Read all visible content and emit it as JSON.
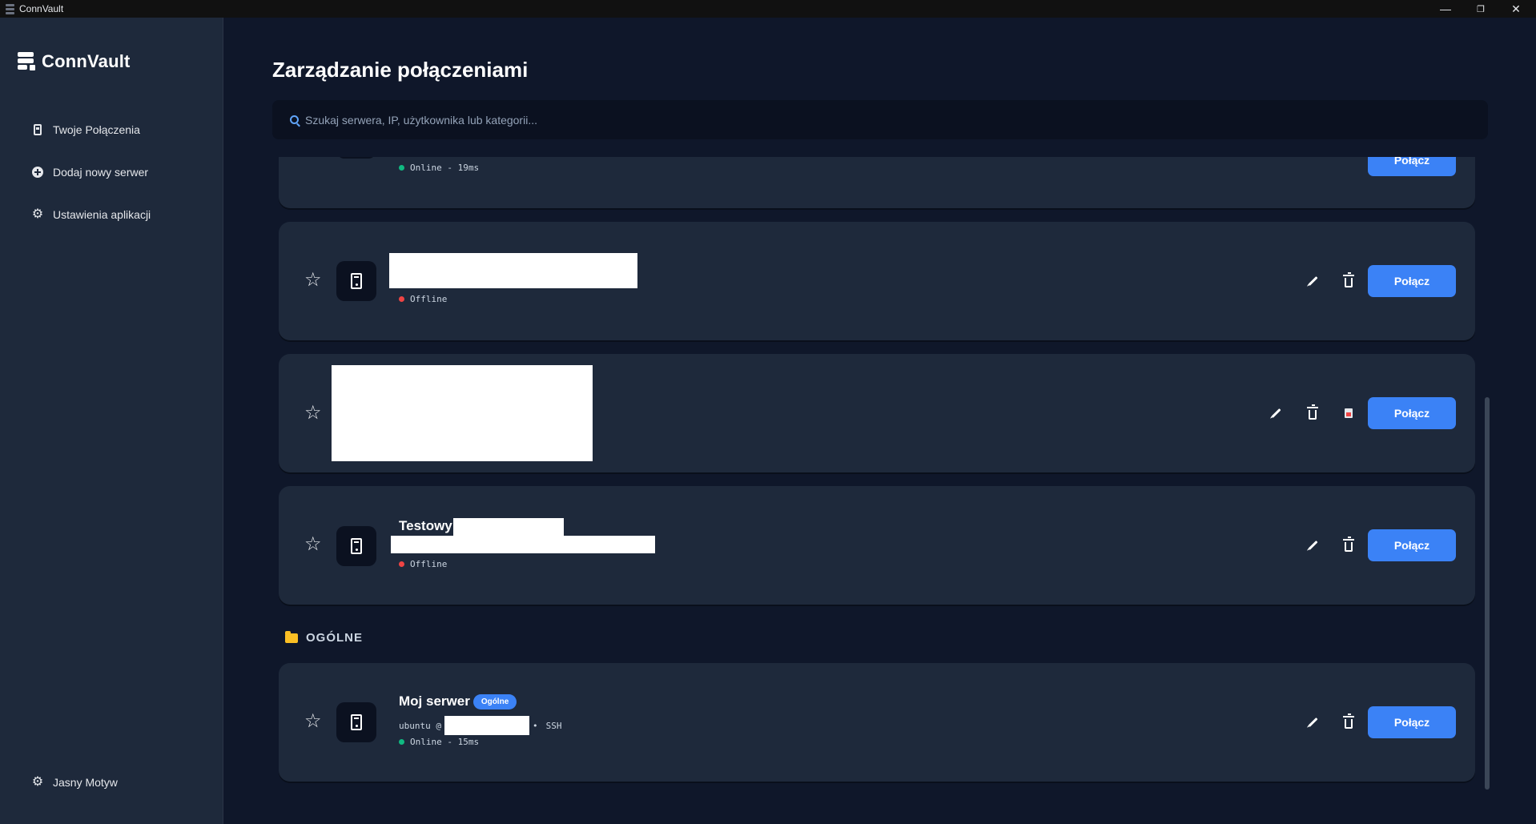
{
  "window": {
    "title": "ConnVault",
    "minimize": "—",
    "restore": "❐",
    "close": "✕"
  },
  "sidebar": {
    "brand": "ConnVault",
    "items": [
      {
        "label": "Twoje Połączenia",
        "icon": "server-icon"
      },
      {
        "label": "Dodaj nowy serwer",
        "icon": "plus-circle-icon"
      },
      {
        "label": "Ustawienia aplikacji",
        "icon": "gear-icon"
      }
    ],
    "theme_toggle": {
      "label": "Jasny Motyw",
      "icon": "gear-icon"
    }
  },
  "main": {
    "title": "Zarządzanie połączeniami",
    "search": {
      "placeholder": "Szukaj serwera, IP, użytkownika lub kategorii...",
      "value": ""
    }
  },
  "servers": [
    {
      "status": "Online - 19ms",
      "status_color": "#10b981",
      "connect_label": "Połącz"
    },
    {
      "status": "Offline",
      "status_color": "#ef4444",
      "connect_label": "Połącz"
    },
    {
      "connect_label": "Połącz"
    },
    {
      "name": "Testowy",
      "status": "Offline",
      "status_color": "#ef4444",
      "connect_label": "Połącz"
    }
  ],
  "sections": [
    {
      "title": "OGÓLNE",
      "servers": [
        {
          "name": "Moj serwer",
          "badge": "Ogólne",
          "user": "ubuntu @",
          "protocol": "SSH",
          "status": "Online - 15ms",
          "status_color": "#10b981",
          "connect_label": "Połącz"
        }
      ]
    }
  ],
  "colors": {
    "accent": "#3b82f6",
    "online": "#10b981",
    "offline": "#ef4444",
    "background": "#0f172a",
    "card": "#1e293b"
  }
}
